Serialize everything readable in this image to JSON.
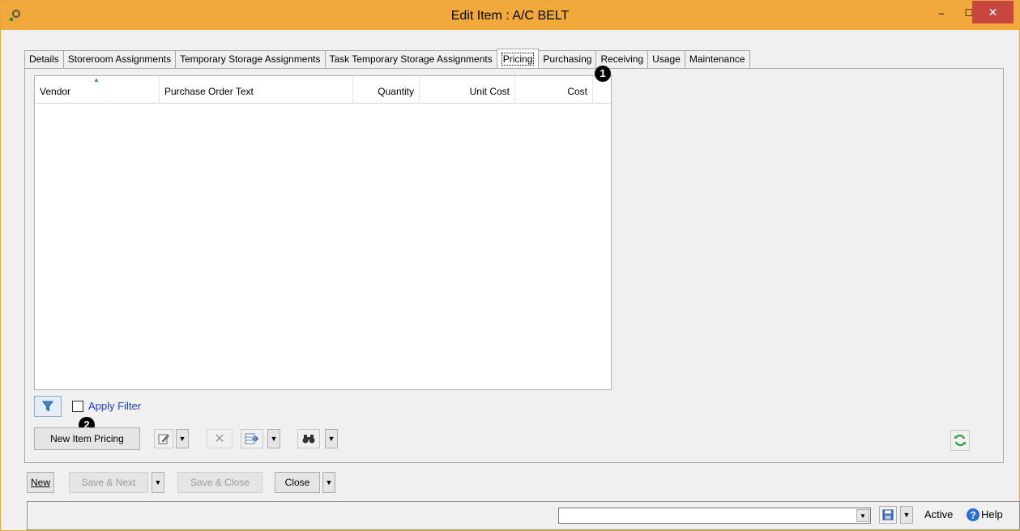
{
  "window": {
    "title": "Edit Item : A/C BELT",
    "minimize_glyph": "–",
    "maximize_glyph": "☐",
    "close_glyph": "✕"
  },
  "tabs": [
    {
      "label": "Details"
    },
    {
      "label": "Storeroom Assignments"
    },
    {
      "label": "Temporary Storage Assignments"
    },
    {
      "label": "Task Temporary Storage Assignments"
    },
    {
      "label": "Pricing",
      "active": true
    },
    {
      "label": "Purchasing"
    },
    {
      "label": "Receiving"
    },
    {
      "label": "Usage"
    },
    {
      "label": "Maintenance"
    }
  ],
  "grid": {
    "columns": {
      "vendor": "Vendor",
      "purchase_order_text": "Purchase Order Text",
      "quantity": "Quantity",
      "unit_cost": "Unit Cost",
      "cost": "Cost"
    },
    "rows": []
  },
  "badges": {
    "one": "1",
    "two": "2"
  },
  "filter": {
    "label": "Apply Filter",
    "checked": false
  },
  "toolbar": {
    "new_item_pricing": "New Item Pricing"
  },
  "footer": {
    "new": "New",
    "save_next": "Save & Next",
    "save_close": "Save & Close",
    "close": "Close"
  },
  "status": {
    "combo_value": "",
    "active": "Active",
    "help": "Help"
  },
  "colors": {
    "titlebar": "#f0a93a",
    "close_button": "#c7463f",
    "filter_link": "#1a3ec8"
  }
}
